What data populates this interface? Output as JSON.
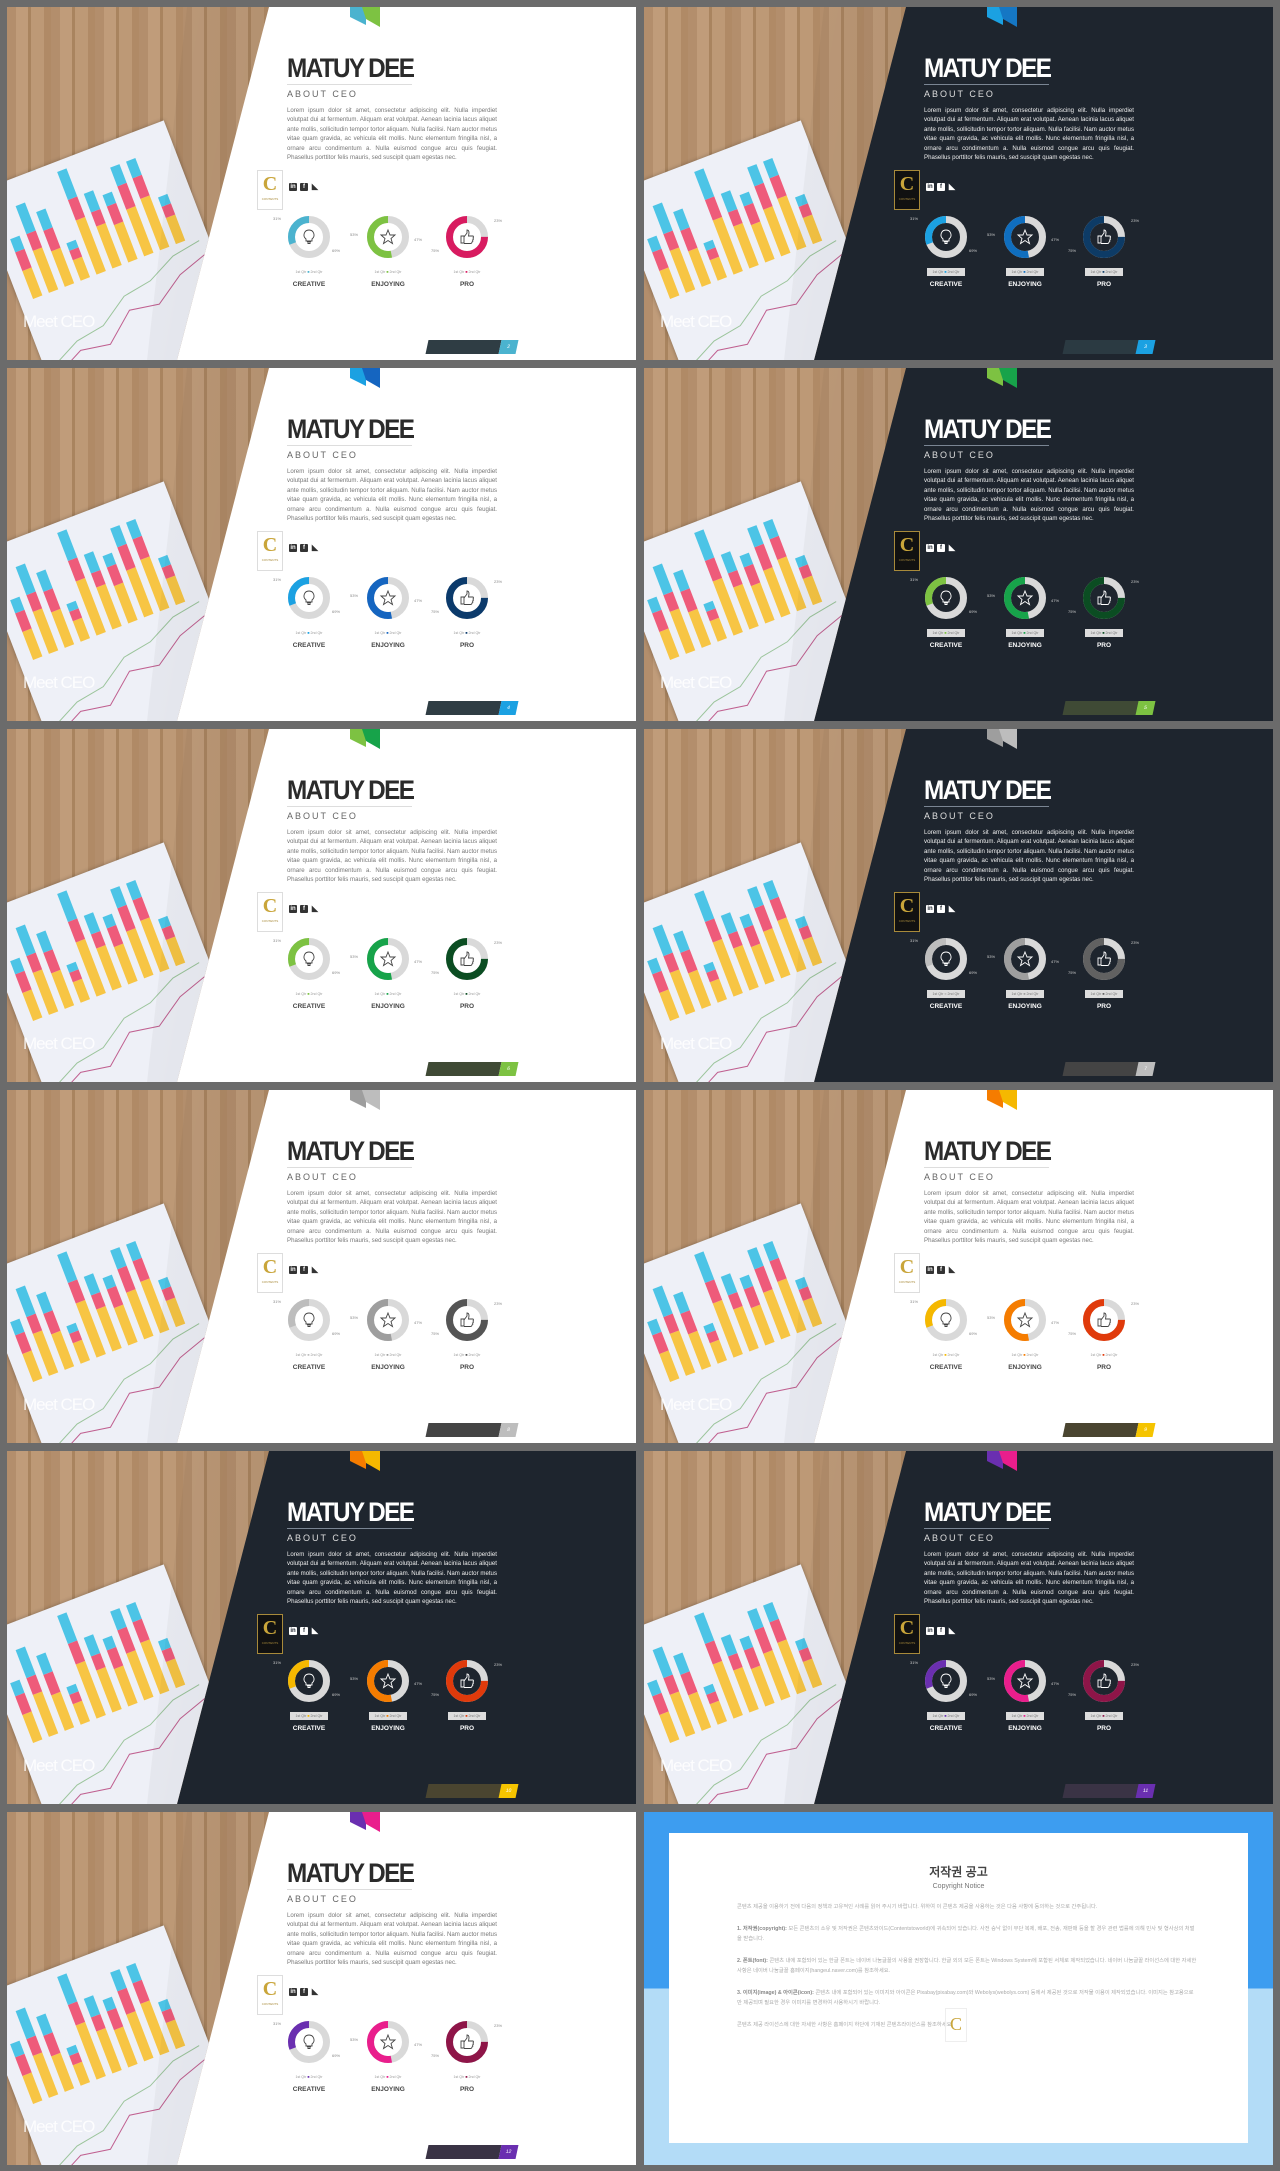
{
  "profile": {
    "name": "MATUY DEE",
    "subtitle": "ABOUT CEO",
    "paragraph": "Lorem ipsum dolor sit amet, consectetur adipiscing elit. Nulla imperdiet volutpat dui at fermentum. Aliquam erat volutpat. Aenean lacinia lacus aliquet ante mollis, sollicitudin tempor tortor aliquam. Nulla facilisi. Nam auctor metus vitae quam gravida, ac vehicula elit mollis. Nunc elementum fringilla nisl, a ornare arcu condimentum a. Nulla euismod congue arcu quis feugiat. Phasellus porttitor felis mauris, sed suscipit quam egestas nec.",
    "photo_caption": "Meet CEO",
    "logo_letter": "C",
    "logo_text": "CONTENTS",
    "social": [
      "linkedin-icon",
      "facebook-icon",
      "twitter-icon"
    ],
    "legend": [
      "1st Qtr",
      "2nd Qtr"
    ],
    "donuts": [
      {
        "label": "CREATIVE",
        "icon": "lightbulb-icon",
        "value": 31,
        "value_label": "31%",
        "rest_label": "69%"
      },
      {
        "label": "ENJOYING",
        "icon": "star-icon",
        "value": 53,
        "value_label": "53%",
        "rest_label": "47%"
      },
      {
        "label": "PRO",
        "icon": "thumbs-up-icon",
        "value": 75,
        "value_label": "75%",
        "rest_label": "23%"
      }
    ]
  },
  "slides": [
    {
      "page": "2",
      "theme": "light",
      "ribbon": [
        "#4bb3cf",
        "#7dc242"
      ],
      "colors": [
        "#4bb3cf",
        "#7dc242",
        "#d81b60"
      ],
      "footer": [
        "#2f3d44",
        "#4bb3cf"
      ]
    },
    {
      "page": "3",
      "theme": "dark",
      "ribbon": [
        "#1ba1e2",
        "#1577c4"
      ],
      "colors": [
        "#1ba1e2",
        "#0f6ebf",
        "#0d3b66"
      ],
      "footer": [
        "#2b3a42",
        "#1ba1e2"
      ]
    },
    {
      "page": "4",
      "theme": "light",
      "ribbon": [
        "#1ba1e2",
        "#1565c0"
      ],
      "colors": [
        "#1ba1e2",
        "#1565c0",
        "#0b3a6b"
      ],
      "footer": [
        "#2f3d44",
        "#1ba1e2"
      ]
    },
    {
      "page": "5",
      "theme": "dark",
      "ribbon": [
        "#7dc242",
        "#17a34a"
      ],
      "colors": [
        "#7dc242",
        "#17a34a",
        "#0b4d22"
      ],
      "footer": [
        "#3f4a35",
        "#7dc242"
      ]
    },
    {
      "page": "6",
      "theme": "light",
      "ribbon": [
        "#7dc242",
        "#17a34a"
      ],
      "colors": [
        "#7dc242",
        "#17a34a",
        "#0b4d22"
      ],
      "footer": [
        "#3f4a35",
        "#7dc242"
      ]
    },
    {
      "page": "7",
      "theme": "dark",
      "ribbon": [
        "#9e9e9e",
        "#bdbdbd"
      ],
      "colors": [
        "#bdbdbd",
        "#9e9e9e",
        "#616161"
      ],
      "footer": [
        "#444444",
        "#bdbdbd"
      ]
    },
    {
      "page": "8",
      "theme": "light",
      "ribbon": [
        "#9e9e9e",
        "#bdbdbd"
      ],
      "colors": [
        "#bdbdbd",
        "#9e9e9e",
        "#555555"
      ],
      "footer": [
        "#444444",
        "#bdbdbd"
      ]
    },
    {
      "page": "9",
      "theme": "light",
      "ribbon": [
        "#f57c00",
        "#f5b800"
      ],
      "colors": [
        "#f5b800",
        "#f57c00",
        "#e03a0b"
      ],
      "footer": [
        "#4a4530",
        "#f5c400"
      ]
    },
    {
      "page": "10",
      "theme": "dark",
      "ribbon": [
        "#f57c00",
        "#f5b800"
      ],
      "colors": [
        "#f5b800",
        "#f57c00",
        "#e03a0b"
      ],
      "footer": [
        "#4a4530",
        "#f5c400"
      ]
    },
    {
      "page": "11",
      "theme": "dark",
      "ribbon": [
        "#6a2fb0",
        "#e91e8c"
      ],
      "colors": [
        "#6a2fb0",
        "#e91e8c",
        "#8e1548"
      ],
      "footer": [
        "#3a3345",
        "#6a2fb0"
      ]
    },
    {
      "page": "12",
      "theme": "light",
      "ribbon": [
        "#6a2fb0",
        "#e91e8c"
      ],
      "colors": [
        "#6a2fb0",
        "#e91e8c",
        "#8e1548"
      ],
      "footer": [
        "#3a3345",
        "#6a2fb0"
      ]
    }
  ],
  "copyright": {
    "title": "저작권 공고",
    "subtitle": "Copyright Notice",
    "intro": "콘텐츠 제공을 이용하기 전에 다음의 정책과 고유적인 사례를 읽어 주시기 바랍니다. 위하여 이 콘텐츠 제공을 사용하는 것은 다음 사항에 동의하는 것으로 간주됩니다.",
    "items": [
      {
        "head": "1. 저작권(copyright):",
        "text": "모든 콘텐츠의 소유 및 저작권은 콘텐츠와이드(Contentstoworld)에 귀속되어 있습니다. 사전 승낙 없이 무단 복제, 배포, 전송, 재판매 등을 할 경우 관련 법률에 의해 민사 및 형사상의 처벌을 받습니다."
      },
      {
        "head": "2. 폰트(font):",
        "text": "콘텐츠 내에 포함되어 있는 한글 폰트는 네이버 나눔글꼴의 사용을 권장합니다. 한글 외의 모든 폰트는 Windows System에 포함된 서체로 제작되었습니다. 네이버 나눔글꼴 라이선스에 대한 자세한 사항은 네이버 나눔글꼴 홈페이지(hangeul.naver.com)를 참조하세요."
      },
      {
        "head": "3. 이미지(image) & 아이콘(icon):",
        "text": "콘텐츠 내에 포함되어 있는 이미지와 아이콘은 Pixabay(pixabay.com)와 Webolys(webolys.com) 등에서 제공된 것으로 저작물 이용이 제작되었습니다. 이미지는 참고용으로만 제공되며 필요한 경우 이미지를 변경하여 사용하시기 바랍니다."
      }
    ],
    "outro": "콘텐츠 제공 라이선스에 대한 자세한 사항은 홈페이지 하단에 기재된 콘텐츠라이선스를 참조하세요."
  }
}
